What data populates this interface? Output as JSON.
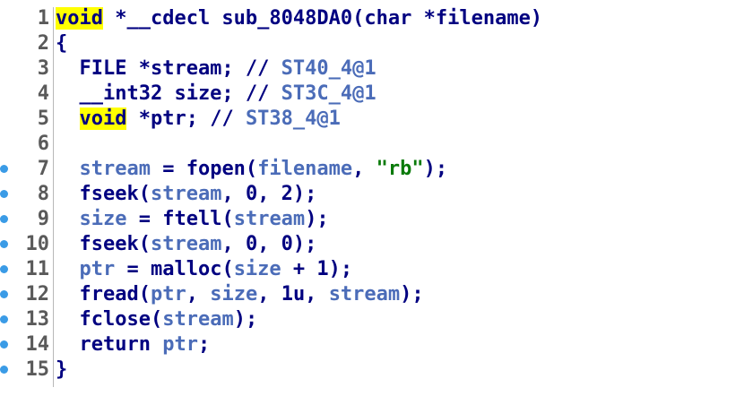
{
  "editor": {
    "lines": [
      {
        "num": "1",
        "breakpoint": false,
        "tokens": [
          {
            "text": "void",
            "cls": "kw-hl"
          },
          {
            "text": " *__cdecl sub_8048DA0(char *filename)",
            "cls": "t-plain"
          }
        ]
      },
      {
        "num": "2",
        "breakpoint": false,
        "tokens": [
          {
            "text": "{",
            "cls": "t-plain"
          }
        ]
      },
      {
        "num": "3",
        "breakpoint": false,
        "tokens": [
          {
            "text": "  FILE *stream; // ",
            "cls": "t-plain"
          },
          {
            "text": "ST40_4@1",
            "cls": "t-comment"
          }
        ]
      },
      {
        "num": "4",
        "breakpoint": false,
        "tokens": [
          {
            "text": "  __int32 size; // ",
            "cls": "t-plain"
          },
          {
            "text": "ST3C_4@1",
            "cls": "t-comment"
          }
        ]
      },
      {
        "num": "5",
        "breakpoint": false,
        "tokens": [
          {
            "text": "  ",
            "cls": "t-plain"
          },
          {
            "text": "void",
            "cls": "kw-hl"
          },
          {
            "text": " *ptr; // ",
            "cls": "t-plain"
          },
          {
            "text": "ST38_4@1",
            "cls": "t-comment"
          }
        ]
      },
      {
        "num": "6",
        "breakpoint": false,
        "tokens": []
      },
      {
        "num": "7",
        "breakpoint": true,
        "tokens": [
          {
            "text": "  stream",
            "cls": "t-var"
          },
          {
            "text": " = fopen(",
            "cls": "t-plain"
          },
          {
            "text": "filename",
            "cls": "t-var"
          },
          {
            "text": ", ",
            "cls": "t-plain"
          },
          {
            "text": "\"rb\"",
            "cls": "t-string"
          },
          {
            "text": ");",
            "cls": "t-plain"
          }
        ]
      },
      {
        "num": "8",
        "breakpoint": true,
        "tokens": [
          {
            "text": "  fseek(",
            "cls": "t-plain"
          },
          {
            "text": "stream",
            "cls": "t-var"
          },
          {
            "text": ", 0, 2);",
            "cls": "t-plain"
          }
        ]
      },
      {
        "num": "9",
        "breakpoint": true,
        "tokens": [
          {
            "text": "  size",
            "cls": "t-var"
          },
          {
            "text": " = ftell(",
            "cls": "t-plain"
          },
          {
            "text": "stream",
            "cls": "t-var"
          },
          {
            "text": ");",
            "cls": "t-plain"
          }
        ]
      },
      {
        "num": "10",
        "breakpoint": true,
        "tokens": [
          {
            "text": "  fseek(",
            "cls": "t-plain"
          },
          {
            "text": "stream",
            "cls": "t-var"
          },
          {
            "text": ", 0, 0);",
            "cls": "t-plain"
          }
        ]
      },
      {
        "num": "11",
        "breakpoint": true,
        "tokens": [
          {
            "text": "  ptr",
            "cls": "t-var"
          },
          {
            "text": " = malloc(",
            "cls": "t-plain"
          },
          {
            "text": "size",
            "cls": "t-var"
          },
          {
            "text": " + 1);",
            "cls": "t-plain"
          }
        ]
      },
      {
        "num": "12",
        "breakpoint": true,
        "tokens": [
          {
            "text": "  fread(",
            "cls": "t-plain"
          },
          {
            "text": "ptr",
            "cls": "t-var"
          },
          {
            "text": ", ",
            "cls": "t-plain"
          },
          {
            "text": "size",
            "cls": "t-var"
          },
          {
            "text": ", 1u, ",
            "cls": "t-plain"
          },
          {
            "text": "stream",
            "cls": "t-var"
          },
          {
            "text": ");",
            "cls": "t-plain"
          }
        ]
      },
      {
        "num": "13",
        "breakpoint": true,
        "tokens": [
          {
            "text": "  fclose(",
            "cls": "t-plain"
          },
          {
            "text": "stream",
            "cls": "t-var"
          },
          {
            "text": ");",
            "cls": "t-plain"
          }
        ]
      },
      {
        "num": "14",
        "breakpoint": true,
        "tokens": [
          {
            "text": "  return ",
            "cls": "t-plain"
          },
          {
            "text": "ptr",
            "cls": "t-var"
          },
          {
            "text": ";",
            "cls": "t-plain"
          }
        ]
      },
      {
        "num": "15",
        "breakpoint": true,
        "tokens": [
          {
            "text": "}",
            "cls": "t-plain"
          }
        ]
      }
    ]
  },
  "colors": {
    "keyword_highlight": "#ffff00",
    "code_text": "#000080",
    "variable": "#4b6cb8",
    "string": "#0a7a0a",
    "line_number": "#5a5a5a",
    "breakpoint_dot": "#3a9be6"
  }
}
